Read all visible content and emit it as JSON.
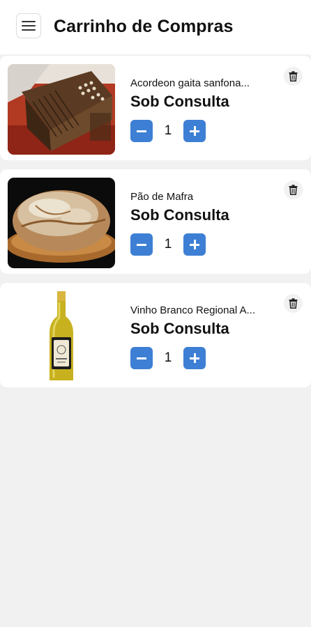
{
  "header": {
    "title": "Carrinho de Compras",
    "menu_icon": "hamburger-menu-icon"
  },
  "cart": {
    "items": [
      {
        "name": "Acordeon gaita sanfona...",
        "price": "Sob Consulta",
        "quantity": "1",
        "image": "accordion-photo"
      },
      {
        "name": "Pão de Mafra",
        "price": "Sob Consulta",
        "quantity": "1",
        "image": "bread-photo"
      },
      {
        "name": "Vinho Branco Regional A...",
        "price": "Sob Consulta",
        "quantity": "1",
        "image": "white-wine-bottle-photo"
      }
    ]
  },
  "icons": {
    "decrease": "minus-icon",
    "increase": "plus-icon",
    "remove": "trash-icon"
  },
  "colors": {
    "accent": "#3d7fd4",
    "background": "#f1f1f1",
    "card": "#ffffff"
  }
}
